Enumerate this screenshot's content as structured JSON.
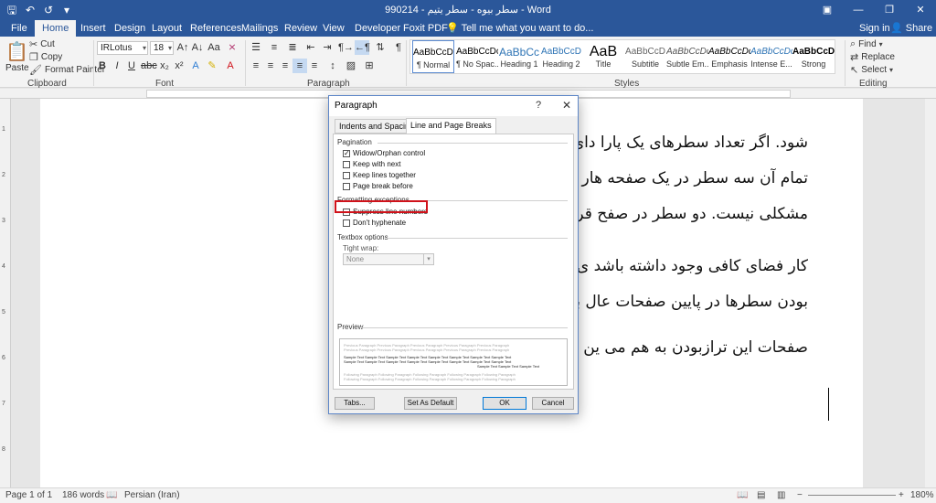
{
  "titlebar": {
    "title": "990214 - سطر بیوه - سطر یتیم - Word",
    "quick_access": [
      "save-icon",
      "undo-icon",
      "redo-icon",
      "customize-icon"
    ]
  },
  "tabs": [
    "File",
    "Home",
    "Insert",
    "Design",
    "Layout",
    "References",
    "Mailings",
    "Review",
    "View",
    "Developer",
    "Foxit PDF"
  ],
  "tellme": "Tell me what you want to do...",
  "signin": "Sign in",
  "share": "Share",
  "ribbon": {
    "clipboard": {
      "label": "Clipboard",
      "paste": "Paste",
      "cut": "Cut",
      "copy": "Copy",
      "format_painter": "Format Painter"
    },
    "font": {
      "label": "Font",
      "font_name": "IRLotus",
      "font_size": "18"
    },
    "paragraph": {
      "label": "Paragraph"
    },
    "styles": {
      "label": "Styles",
      "items": [
        {
          "preview": "AaBbCcDc",
          "name": "¶ Normal"
        },
        {
          "preview": "AaBbCcDc",
          "name": "¶ No Spac..."
        },
        {
          "preview": "AaBbCc",
          "name": "Heading 1"
        },
        {
          "preview": "AaBbCcD",
          "name": "Heading 2"
        },
        {
          "preview": "AaB",
          "name": "Title"
        },
        {
          "preview": "AaBbCcD",
          "name": "Subtitle"
        },
        {
          "preview": "AaBbCcDc",
          "name": "Subtle Em..."
        },
        {
          "preview": "AaBbCcDc",
          "name": "Emphasis"
        },
        {
          "preview": "AaBbCcDc",
          "name": "Intense E..."
        },
        {
          "preview": "AaBbCcDc",
          "name": "Strong"
        }
      ]
    },
    "editing": {
      "label": "Editing",
      "find": "Find",
      "replace": "Replace",
      "select": "Select"
    }
  },
  "document": {
    "lines": [
      "شود. اگر تعداد سطرهای یک پارا                               دای صفحه قرار گرفته باشد،",
      "تمام آن سه سطر در یک صفحه                               هار سطر تبدیل شود، دیگر",
      "مشکلی نیست. دو سطر در صفح                               قرار می‌گیرد. (اگر برای این",
      "کار فضای کافی وجود داشته باشد                               ی برخی مهم است، هم‌تراز",
      "بودن سطرها در پایین صفحات                               عال باشد، ناچار در بعضی",
      "صفحات این ترازبودن به هم می                               ین تنظیم را تغییر داد."
    ]
  },
  "status": {
    "page": "Page 1 of 1",
    "words": "186 words",
    "language": "Persian (Iran)",
    "zoom": "180%"
  },
  "dialog": {
    "title": "Paragraph",
    "help": "?",
    "close": "✕",
    "tabs": [
      "Indents and Spacing",
      "Line and Page Breaks"
    ],
    "pagination": {
      "label": "Pagination",
      "options": [
        {
          "label": "Widow/Orphan control",
          "checked": true
        },
        {
          "label": "Keep with next",
          "checked": false
        },
        {
          "label": "Keep lines together",
          "checked": false
        },
        {
          "label": "Page break before",
          "checked": false
        }
      ]
    },
    "formatting": {
      "label": "Formatting exceptions",
      "options": [
        {
          "label": "Suppress line numbers",
          "checked": false
        },
        {
          "label": "Don't hyphenate",
          "checked": false
        }
      ]
    },
    "textbox": {
      "label": "Textbox options",
      "tight_wrap_label": "Tight wrap:",
      "tight_wrap_value": "None"
    },
    "preview": {
      "label": "Preview",
      "prev_text": "Previous Paragraph Previous Paragraph Previous Paragraph Previous Paragraph Previous Paragraph",
      "sample_text": "Sample Text Sample Text Sample Text Sample Text Sample Text Sample Text Sample Text Sample Text",
      "sample_tail": "Sample Text Sample Text Sample Text",
      "next_text": "Following Paragraph Following Paragraph Following Paragraph Following Paragraph Following Paragraph"
    },
    "buttons": {
      "tabs": "Tabs...",
      "set_default": "Set As Default",
      "ok": "OK",
      "cancel": "Cancel"
    }
  }
}
